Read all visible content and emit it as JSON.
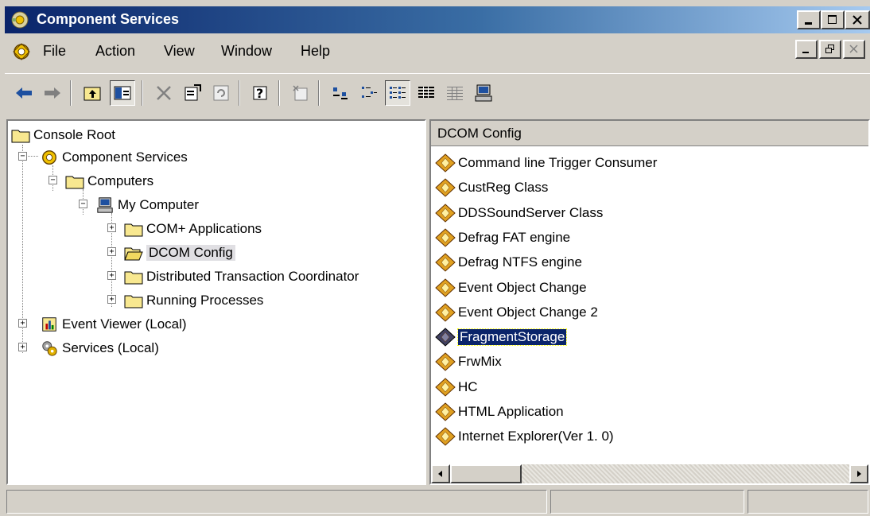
{
  "window": {
    "title": "Component Services"
  },
  "menu": {
    "items": [
      "File",
      "Action",
      "View",
      "Window",
      "Help"
    ]
  },
  "toolbar": {
    "buttons": [
      "back-icon",
      "forward-icon",
      "up-folder-icon",
      "show-hide-tree-icon",
      "delete-icon",
      "properties-icon",
      "refresh-icon",
      "help-icon",
      "new-window-icon",
      "large-icons-icon",
      "small-icons-icon",
      "list-icon",
      "details-icon",
      "detail-grid-icon",
      "computer-icon"
    ]
  },
  "tree": {
    "root": "Console Root",
    "component_services": "Component Services",
    "computers": "Computers",
    "my_computer": "My Computer",
    "com_apps": "COM+ Applications",
    "dcom_config": "DCOM Config",
    "dtc": "Distributed Transaction Coordinator",
    "running": "Running Processes",
    "event_viewer": "Event Viewer (Local)",
    "services": "Services (Local)"
  },
  "list": {
    "header": "DCOM Config",
    "items": [
      "Command line Trigger Consumer",
      "CustReg Class",
      "DDSSoundServer Class",
      "Defrag FAT engine",
      "Defrag NTFS engine",
      "Event Object Change",
      "Event Object Change 2",
      "FragmentStorage",
      "FrwMix",
      "HC",
      "HTML Application",
      "Internet Explorer(Ver 1. 0)"
    ],
    "selected_index": 7
  },
  "colors": {
    "title_start": "#0a246a",
    "title_end": "#a6caf0",
    "selection": "#0a246a"
  }
}
